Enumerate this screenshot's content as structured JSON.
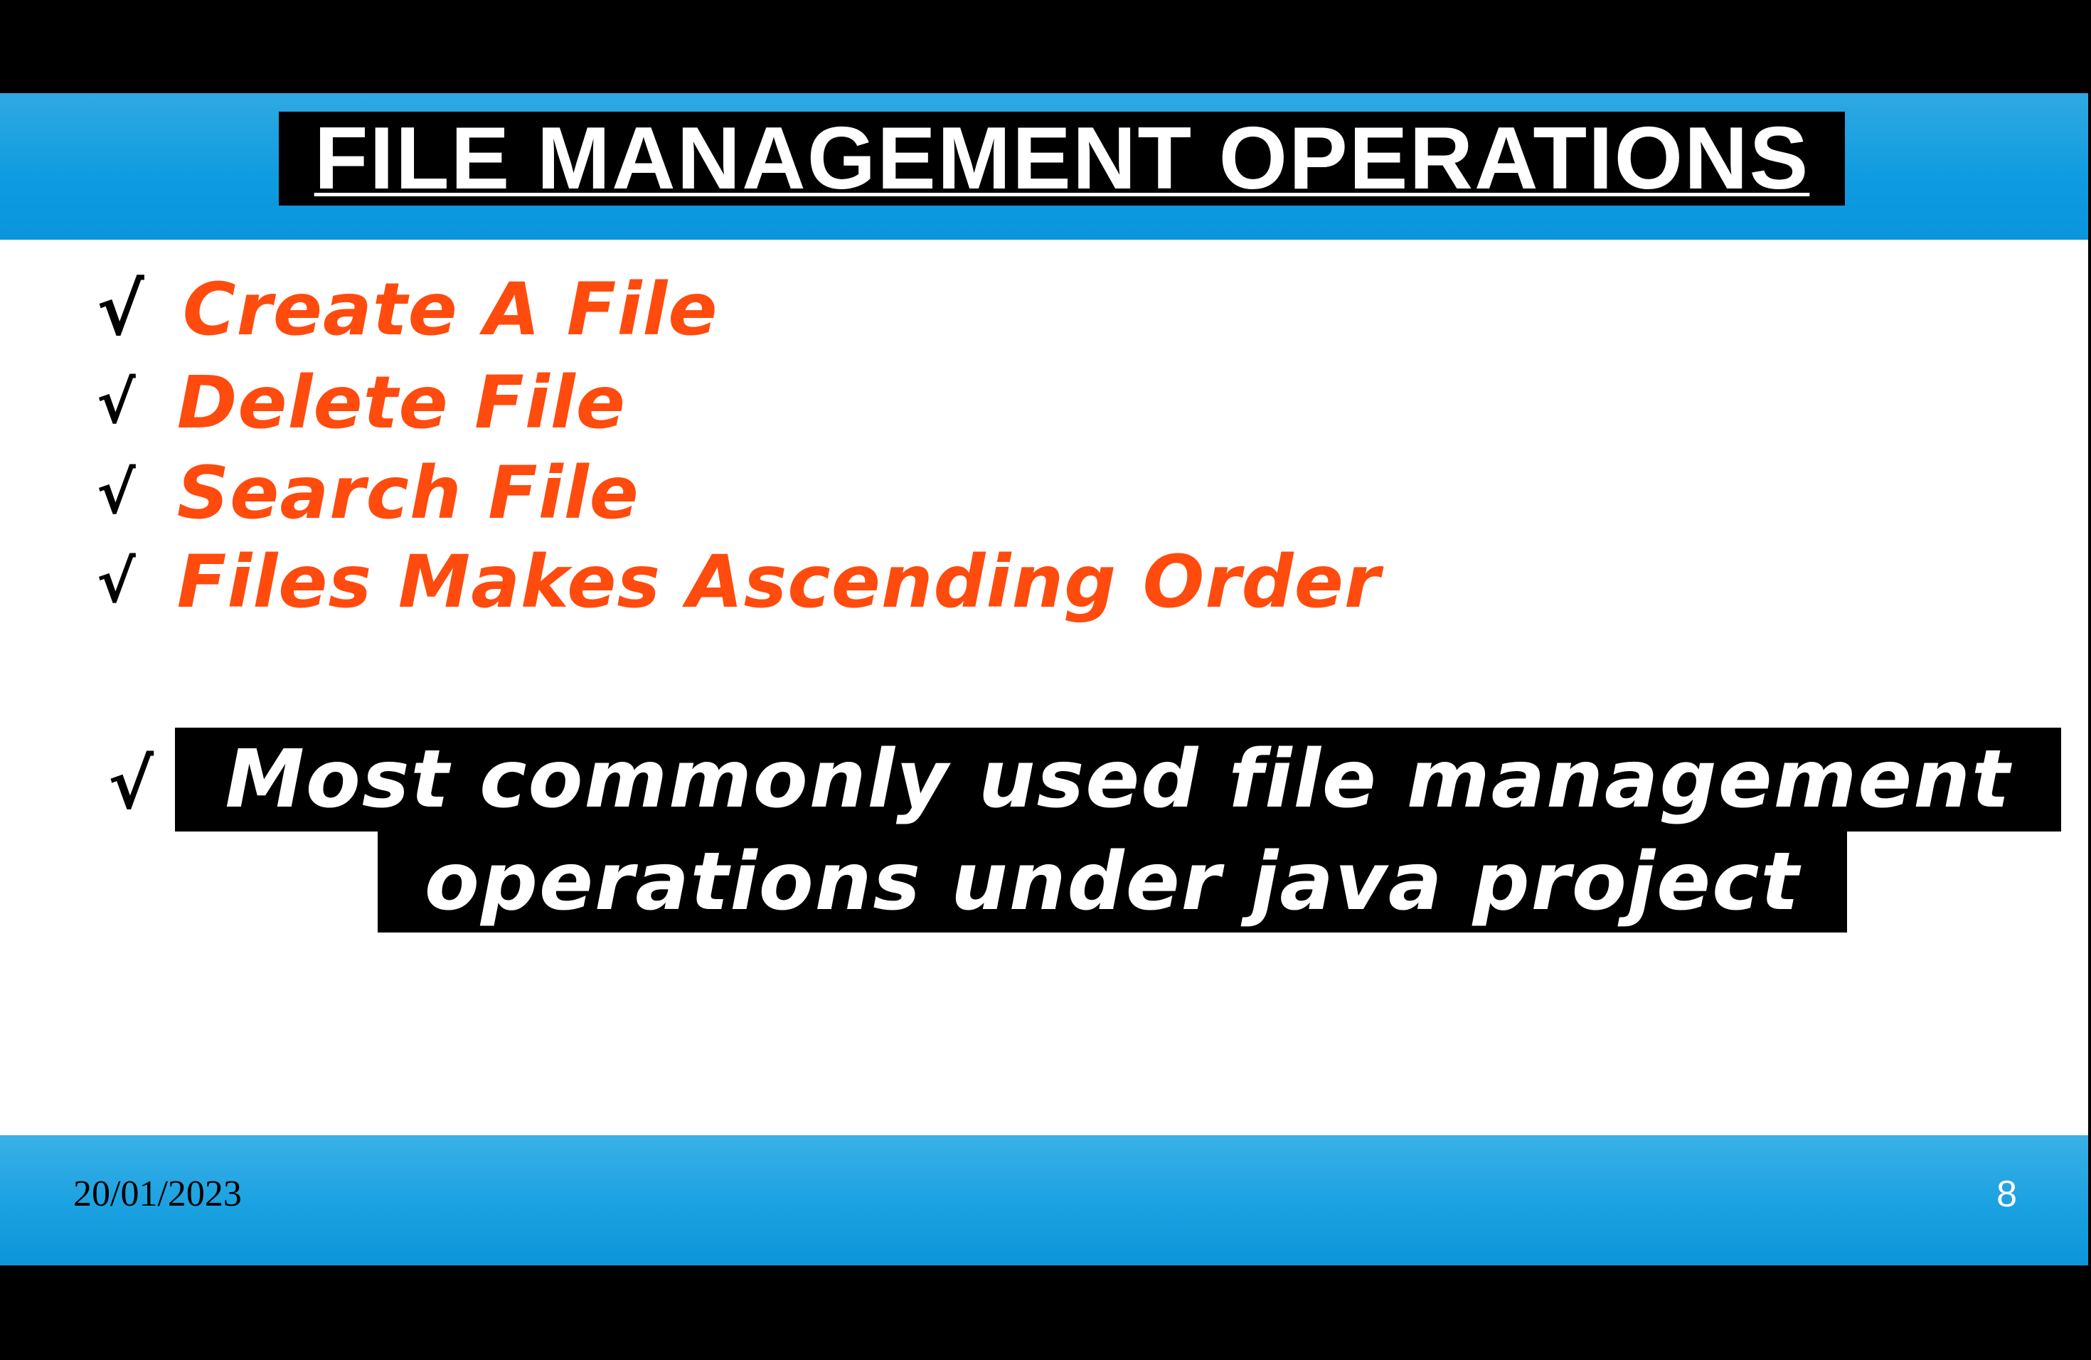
{
  "slide": {
    "title": "FILE MANAGEMENT OPERATIONS",
    "check_glyph": "√",
    "items": [
      {
        "label": "Create A File"
      },
      {
        "label": "Delete File"
      },
      {
        "label": "Search File"
      },
      {
        "label": "Files Makes Ascending Order"
      }
    ],
    "note": {
      "line1": "Most commonly used file management",
      "line2": "operations under java project"
    },
    "footer": {
      "date": "20/01/2023",
      "page_number": "8"
    }
  },
  "colors": {
    "header_band": "#0e9be0",
    "footer_band": "#1aa1e1",
    "item_text": "#ff4b0e",
    "title_box": "#000000",
    "title_text": "#ffffff"
  }
}
